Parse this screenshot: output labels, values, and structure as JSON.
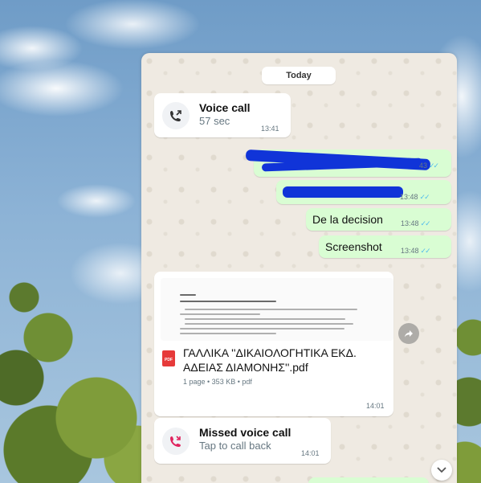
{
  "chat": {
    "date_label": "Today",
    "voice_call": {
      "title": "Voice call",
      "duration": "57 sec",
      "time": "13:41",
      "icon": "outgoing-call-icon"
    },
    "redacted_message_1": {
      "time_partial": "43",
      "ticks": "✓✓"
    },
    "redacted_message_2": {
      "time": "13:48",
      "ticks": "✓✓"
    },
    "message_decision": {
      "text": "De la decision",
      "time": "13:48",
      "ticks": "✓✓"
    },
    "message_screenshot": {
      "text": "Screenshot",
      "time": "13:48",
      "ticks": "✓✓"
    },
    "document": {
      "name": "ΓΑΛΛΙΚΑ ''ΔΙΚΑΙΟΛΟΓΗΤΙΚΑ ΕΚΔ. ΑΔΕΙΑΣ ΔΙΑΜΟΝΗΣ''.pdf",
      "meta": "1 page • 353 KB • pdf",
      "time": "14:01",
      "badge": "PDF"
    },
    "missed_call": {
      "title": "Missed voice call",
      "subtitle": "Tap to call back",
      "time": "14:01",
      "icon": "missed-call-icon"
    }
  },
  "colors": {
    "outgoing_bubble": "#d9fdd3",
    "read_ticks": "#53bdeb",
    "scribble": "#1034d8",
    "missed_call": "#e0245e"
  }
}
